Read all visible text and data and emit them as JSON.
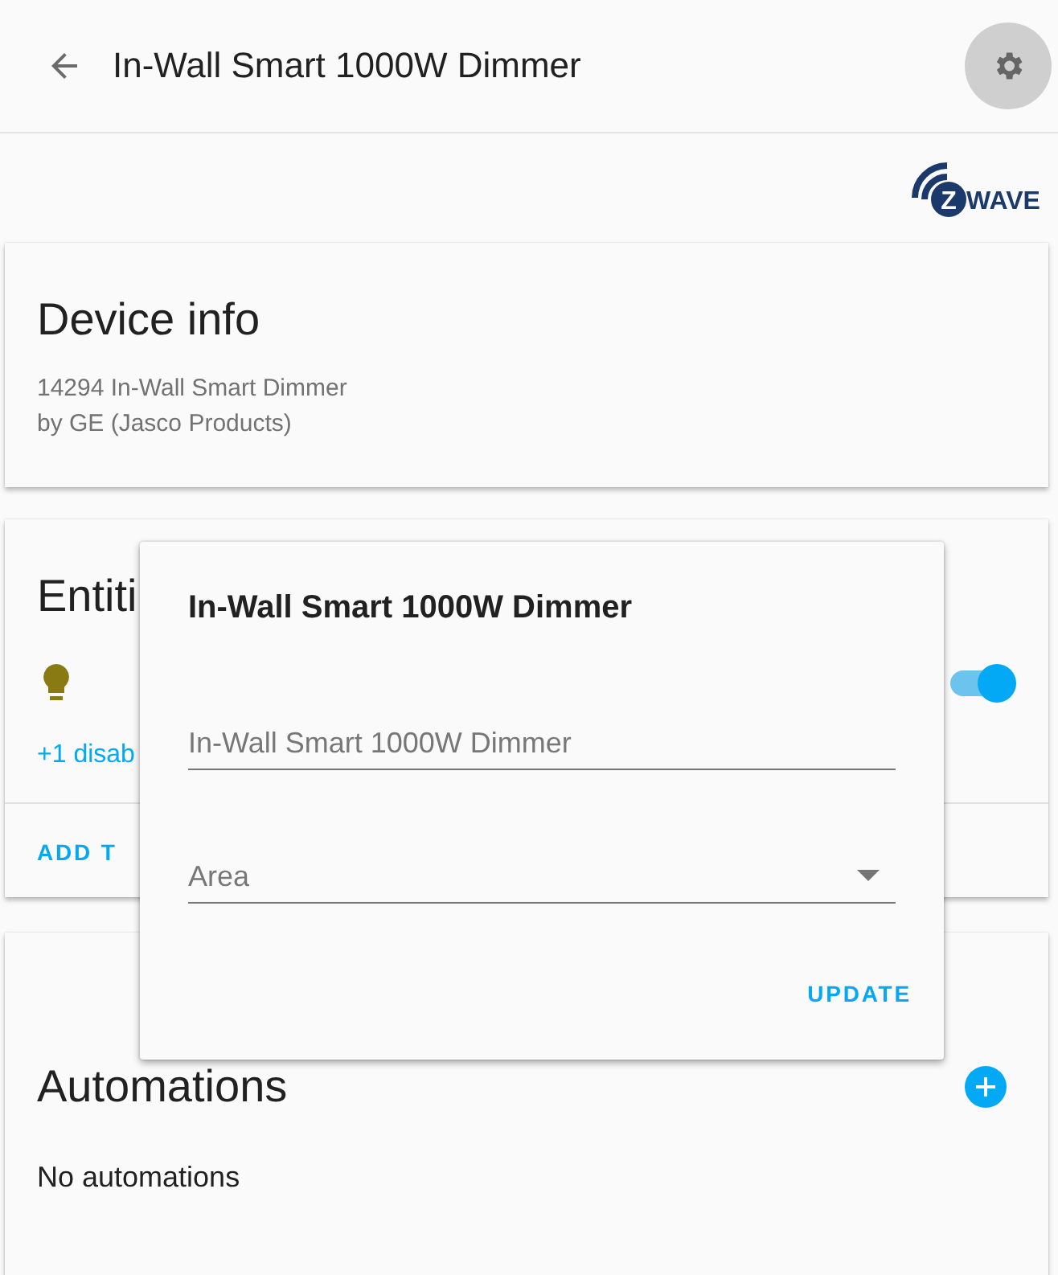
{
  "header": {
    "title": "In-Wall Smart 1000W Dimmer"
  },
  "logo": {
    "mark": "Z",
    "word": "WAVE"
  },
  "device_info": {
    "title": "Device info",
    "lines": [
      "14294 In-Wall Smart Dimmer",
      "by GE (Jasco Products)"
    ]
  },
  "entities": {
    "title": "Entiti",
    "toggle": {
      "on": true
    },
    "disabled_link": "+1 disab",
    "action": "ADD T"
  },
  "automations": {
    "title": "Automations",
    "empty": "No automations"
  },
  "dialog": {
    "title": "In-Wall Smart 1000W Dimmer",
    "name_field": {
      "placeholder": "In-Wall Smart 1000W Dimmer"
    },
    "area_field": {
      "placeholder": "Area"
    },
    "button": "UPDATE"
  }
}
